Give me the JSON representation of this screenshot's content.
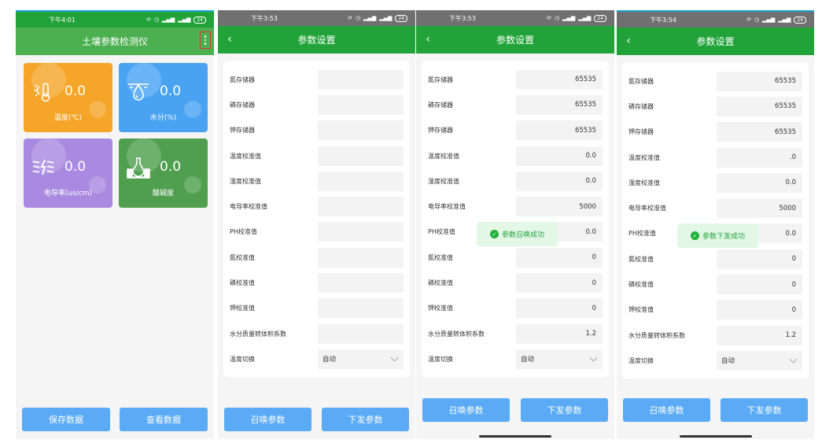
{
  "screen1": {
    "status": {
      "time": "下午4:01",
      "battery": "24"
    },
    "header": {
      "title": "土壤参数检测仪",
      "more_icon": "more-vert-icon"
    },
    "tiles": [
      {
        "icon": "thermometer-sun-icon",
        "value": "0.0",
        "label": "温度(℃)",
        "color": "#f5a528"
      },
      {
        "icon": "water-drop-icon",
        "value": "0.0",
        "label": "水分(%)",
        "color": "#4aa3f2"
      },
      {
        "icon": "conductivity-icon",
        "value": "0.0",
        "label": "电导率(us/cm)",
        "color": "#a98ae0"
      },
      {
        "icon": "ph-flask-icon",
        "value": "0.0",
        "label": "酸碱度",
        "color": "#4f9f4f"
      }
    ],
    "buttons": {
      "save": "保存数据",
      "view": "查看数据"
    }
  },
  "params_labels": [
    "氮存储器",
    "磷存储器",
    "钾存储器",
    "温度校准值",
    "湿度校准值",
    "电导率校准值",
    "PH校准值",
    "氮校准值",
    "磷校准值",
    "钾校准值",
    "水分质量转体积系数",
    "温度切换"
  ],
  "screen2": {
    "status": {
      "time": "下午3:53",
      "battery": "24"
    },
    "header": {
      "title": "参数设置"
    },
    "values": [
      "",
      "",
      "",
      "",
      "",
      "",
      "",
      "",
      "",
      "",
      ""
    ],
    "temp_switch": "自动",
    "buttons": {
      "recall": "召唤参数",
      "send": "下发参数"
    }
  },
  "screen3": {
    "status": {
      "time": "下午3:53",
      "battery": "24"
    },
    "header": {
      "title": "参数设置"
    },
    "values": [
      "65535",
      "65535",
      "65535",
      "0.0",
      "0.0",
      "5000",
      "0.0",
      "0",
      "0",
      "0",
      "1.2"
    ],
    "temp_switch": "自动",
    "toast": "参数召唤成功",
    "buttons": {
      "recall": "召唤参数",
      "send": "下发参数"
    }
  },
  "screen4": {
    "status": {
      "time": "下午3:54",
      "battery": "24"
    },
    "header": {
      "title": "参数设置"
    },
    "values": [
      "65535",
      "65535",
      "65535",
      ".0",
      "0.0",
      "5000",
      "0.0",
      "0",
      "0",
      "0",
      "1.2"
    ],
    "temp_switch": "自动",
    "toast": "参数下发成功",
    "buttons": {
      "recall": "召唤参数",
      "send": "下发参数"
    }
  }
}
